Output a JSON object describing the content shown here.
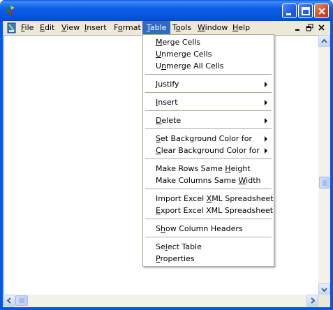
{
  "menubar": {
    "items": [
      {
        "label": "File",
        "accel": "F",
        "rest": "ile"
      },
      {
        "label": "Edit",
        "accel": "E",
        "rest": "dit"
      },
      {
        "label": "View",
        "accel": "V",
        "rest": "iew"
      },
      {
        "label": "Insert",
        "accel": "I",
        "rest": "nsert"
      },
      {
        "label": "Format",
        "pre": "F",
        "accel": "o",
        "rest": "rmat"
      },
      {
        "label": "Table",
        "accel": "T",
        "rest": "able"
      },
      {
        "label": "Tools",
        "pre": "T",
        "accel": "o",
        "rest": "ols"
      },
      {
        "label": "Window",
        "accel": "W",
        "rest": "indow"
      },
      {
        "label": "Help",
        "accel": "H",
        "rest": "elp"
      }
    ],
    "active": "Table"
  },
  "table_menu": {
    "merge_cells": {
      "accel": "M",
      "rest": "erge Cells"
    },
    "unmerge_cells": {
      "accel": "U",
      "rest": "nmerge Cells"
    },
    "unmerge_all_cells": {
      "pre": "U",
      "accel": "n",
      "rest": "merge All Cells"
    },
    "justify": {
      "accel": "J",
      "rest": "ustify"
    },
    "insert": {
      "accel": "I",
      "rest": "nsert"
    },
    "delete": {
      "accel": "D",
      "rest": "elete"
    },
    "set_bg": {
      "accel": "S",
      "rest": "et Background Color for"
    },
    "clear_bg": {
      "accel": "C",
      "rest": "lear Background Color for"
    },
    "rows_same_height": {
      "pre": "Make Rows Same ",
      "accel": "H",
      "rest": "eight"
    },
    "cols_same_width": {
      "pre": "Make Columns Same ",
      "accel": "W",
      "rest": "idth"
    },
    "import_xml": {
      "pre": "Import Excel ",
      "accel": "X",
      "rest": "ML Spreadsheet"
    },
    "export_xml": {
      "accel": "E",
      "rest": "xport Excel XML Spreadsheet"
    },
    "show_headers": {
      "pre": "S",
      "accel": "h",
      "rest": "ow Column Headers"
    },
    "select_table": {
      "pre": "Se",
      "accel": "l",
      "rest": "ect Table"
    },
    "properties": {
      "accel": "P",
      "rest": "roperties"
    }
  },
  "icons": {
    "app": "sj-app-icon",
    "document": "document-icon",
    "minimize": "minimize-icon",
    "maximize": "maximize-icon",
    "close": "close-icon"
  }
}
